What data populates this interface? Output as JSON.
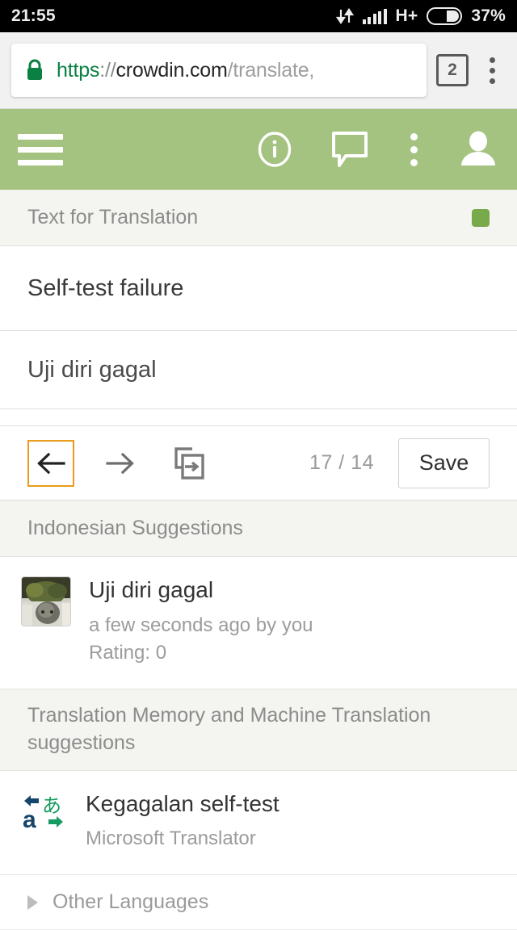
{
  "statusbar": {
    "time": "21:55",
    "network_type": "H+",
    "battery_percent": "37%",
    "icons": [
      "data-transfer-icon",
      "signal-icon",
      "battery-icon"
    ]
  },
  "browser": {
    "url_scheme": "https",
    "url_separator": "://",
    "url_host": "crowdin.com",
    "url_path": "/translate,",
    "lock_icon": "lock-icon",
    "tab_count": "2",
    "menu_icon": "kebab-menu-icon"
  },
  "appbar": {
    "menu_icon": "hamburger-menu-icon",
    "info_icon": "info-icon",
    "comment_icon": "comment-icon",
    "more_icon": "kebab-menu-icon",
    "account_icon": "account-icon",
    "background_color": "#a4c280"
  },
  "editor": {
    "section_label": "Text for Translation",
    "status_color": "#78a94a",
    "source_text": "Self-test failure",
    "target_text": "Uji diri gagal"
  },
  "toolbar": {
    "prev_icon": "arrow-left-icon",
    "next_icon": "arrow-right-icon",
    "copy_source_icon": "copy-source-icon",
    "counter": "17 / 14",
    "save_label": "Save",
    "focus_color": "#e89b1c"
  },
  "suggestions": {
    "header": "Indonesian Suggestions",
    "items": [
      {
        "text": "Uji diri gagal",
        "meta_time": "a few seconds ago by you",
        "meta_rating": "Rating: 0",
        "avatar": "user-avatar-photo"
      }
    ]
  },
  "machine_translation": {
    "header": "Translation Memory and Machine Translation suggestions",
    "items": [
      {
        "text": "Kegagalan self-test",
        "provider": "Microsoft Translator",
        "icon": "microsoft-translator-icon"
      }
    ]
  },
  "other_languages": {
    "label": "Other Languages",
    "expand_icon": "triangle-right-icon"
  }
}
